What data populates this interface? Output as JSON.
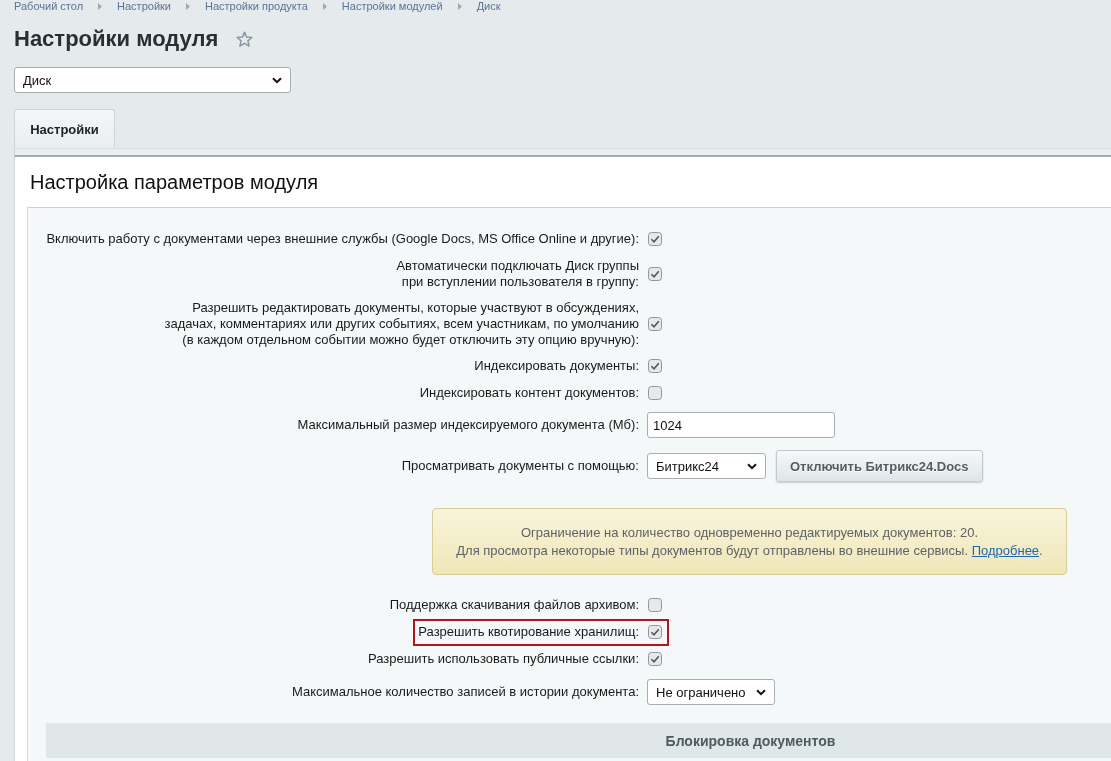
{
  "breadcrumbs": [
    "Рабочий стол",
    "Настройки",
    "Настройки продукта",
    "Настройки модулей",
    "Диск"
  ],
  "title": "Настройки модуля",
  "module_select": {
    "value": "Диск"
  },
  "tabs": [
    {
      "label": "Настройки",
      "selected": true
    }
  ],
  "section_title": "Настройка параметров модуля",
  "settings": [
    {
      "kind": "checkbox",
      "lines": [
        "Включить работу с документами через внешние службы (Google Docs, MS Office Online и другие):"
      ],
      "checked": true,
      "highlighted": false
    },
    {
      "kind": "checkbox",
      "lines": [
        "Автоматически подключать Диск группы",
        "при вступлении пользователя в группу:"
      ],
      "checked": true,
      "highlighted": false
    },
    {
      "kind": "checkbox",
      "lines": [
        "Разрешить редактировать документы, которые участвуют в обсуждениях,",
        "задачах, комментариях или других событиях, всем участникам, по умолчанию",
        "(в каждом отдельном событии можно будет отключить эту опцию вручную):"
      ],
      "checked": true,
      "highlighted": false
    },
    {
      "kind": "checkbox",
      "lines": [
        "Индексировать документы:"
      ],
      "checked": true,
      "highlighted": false
    },
    {
      "kind": "checkbox",
      "lines": [
        "Индексировать контент документов:"
      ],
      "checked": false,
      "highlighted": false
    },
    {
      "kind": "text",
      "lines": [
        "Максимальный размер индексируемого документа (Мб):"
      ],
      "value": "1024"
    },
    {
      "kind": "select",
      "lines": [
        "Просматривать документы с помощью:"
      ],
      "value": "Битрикс24",
      "button": "Отключить Битрикс24.Docs"
    },
    {
      "kind": "notice",
      "line1": "Ограничение на количество одновременно редактируемых документов: 20.",
      "line2": "Для просмотра некоторые типы документов будут отправлены во внешние сервисы.",
      "link": "Подробнее",
      "line2_end": "."
    },
    {
      "kind": "checkbox",
      "lines": [
        "Поддержка скачивания файлов архивом:"
      ],
      "checked": false,
      "highlighted": false
    },
    {
      "kind": "checkbox",
      "lines": [
        "Разрешить квотирование хранилищ:"
      ],
      "checked": true,
      "highlighted": true
    },
    {
      "kind": "checkbox",
      "lines": [
        "Разрешить использовать публичные ссылки:"
      ],
      "checked": true,
      "highlighted": false
    },
    {
      "kind": "select",
      "lines": [
        "Максимальное количество записей в истории документа:"
      ],
      "value": "Не ограничено"
    },
    {
      "kind": "section",
      "label": "Блокировка документов"
    }
  ]
}
